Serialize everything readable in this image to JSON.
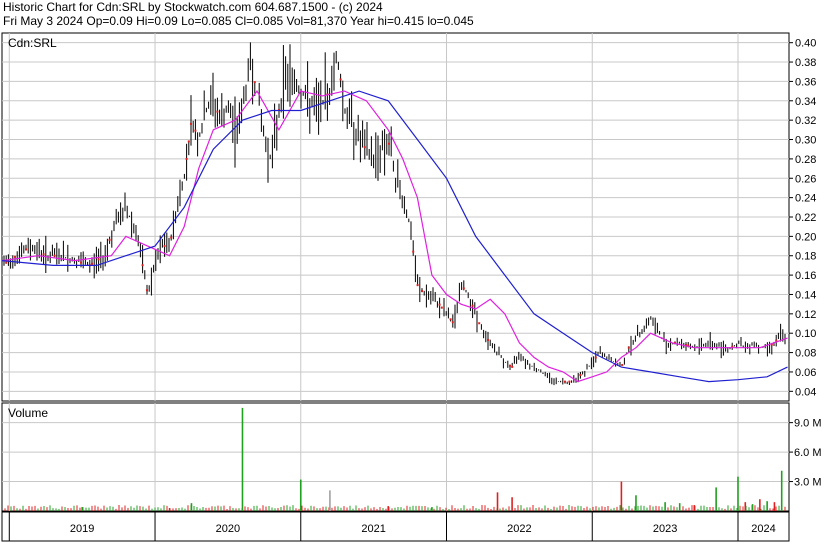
{
  "header": {
    "line1": "Historic Chart for Cdn:SRL by Stockwatch.com 604.687.1500 - (c) 2024",
    "line2": "Fri May  3 2024  Op=0.09  Hi=0.09  Lo=0.085  Cl=0.085  Vol=81,370  Year hi=0.415  lo=0.045"
  },
  "colors": {
    "price": "#000000",
    "ma_short": "#e020e0",
    "ma_long": "#2020d0",
    "vol_up": "#20a020",
    "vol_down": "#e02020",
    "vol_flat": "#a0a0a0",
    "grid": "#c8c8c8"
  },
  "chart_data": [
    {
      "type": "line",
      "symbol_label": "Cdn:SRL",
      "ylim": [
        0.03,
        0.41
      ],
      "y_ticks": [
        "0.40",
        "0.38",
        "0.36",
        "0.34",
        "0.32",
        "0.30",
        "0.28",
        "0.26",
        "0.24",
        "0.22",
        "0.20",
        "0.18",
        "0.16",
        "0.14",
        "0.12",
        "0.10",
        "0.08",
        "0.06",
        "0.04"
      ],
      "x_ticks": [
        "2019",
        "2020",
        "2021",
        "2022",
        "2023",
        "2024"
      ],
      "xlim": [
        2018.95,
        2024.35
      ],
      "series": [
        {
          "key": "close",
          "x": [
            2018.95,
            2019.05,
            2019.15,
            2019.25,
            2019.35,
            2019.45,
            2019.55,
            2019.65,
            2019.72,
            2019.8,
            2019.88,
            2019.95,
            2020.0,
            2020.05,
            2020.1,
            2020.15,
            2020.2,
            2020.25,
            2020.3,
            2020.35,
            2020.4,
            2020.45,
            2020.5,
            2020.55,
            2020.6,
            2020.65,
            2020.7,
            2020.75,
            2020.8,
            2020.85,
            2020.9,
            2020.95,
            2021.0,
            2021.05,
            2021.1,
            2021.15,
            2021.2,
            2021.25,
            2021.3,
            2021.35,
            2021.4,
            2021.45,
            2021.5,
            2021.55,
            2021.6,
            2021.65,
            2021.7,
            2021.75,
            2021.8,
            2021.85,
            2021.9,
            2021.95,
            2022.0,
            2022.05,
            2022.1,
            2022.15,
            2022.2,
            2022.25,
            2022.3,
            2022.35,
            2022.4,
            2022.45,
            2022.5,
            2022.55,
            2022.6,
            2022.65,
            2022.7,
            2022.75,
            2022.8,
            2022.85,
            2022.9,
            2022.95,
            2023.0,
            2023.05,
            2023.1,
            2023.15,
            2023.2,
            2023.25,
            2023.3,
            2023.4,
            2023.5,
            2023.6,
            2023.7,
            2023.8,
            2023.9,
            2023.95,
            2024.0,
            2024.05,
            2024.1,
            2024.15,
            2024.2,
            2024.25,
            2024.3,
            2024.34
          ],
          "values": [
            0.17,
            0.18,
            0.19,
            0.18,
            0.18,
            0.175,
            0.17,
            0.18,
            0.21,
            0.23,
            0.2,
            0.14,
            0.17,
            0.19,
            0.19,
            0.23,
            0.26,
            0.32,
            0.3,
            0.33,
            0.34,
            0.32,
            0.33,
            0.31,
            0.33,
            0.38,
            0.35,
            0.3,
            0.28,
            0.33,
            0.37,
            0.36,
            0.35,
            0.34,
            0.33,
            0.34,
            0.35,
            0.39,
            0.33,
            0.32,
            0.3,
            0.29,
            0.28,
            0.29,
            0.3,
            0.26,
            0.24,
            0.21,
            0.15,
            0.14,
            0.135,
            0.13,
            0.12,
            0.11,
            0.15,
            0.14,
            0.12,
            0.1,
            0.09,
            0.08,
            0.07,
            0.065,
            0.08,
            0.07,
            0.065,
            0.06,
            0.055,
            0.05,
            0.05,
            0.05,
            0.055,
            0.06,
            0.07,
            0.08,
            0.075,
            0.07,
            0.065,
            0.085,
            0.095,
            0.115,
            0.09,
            0.09,
            0.085,
            0.09,
            0.085,
            0.085,
            0.09,
            0.085,
            0.09,
            0.085,
            0.085,
            0.09,
            0.1,
            0.085
          ]
        },
        {
          "key": "ma_short",
          "x": [
            2018.95,
            2019.2,
            2019.45,
            2019.7,
            2019.8,
            2019.95,
            2020.1,
            2020.2,
            2020.3,
            2020.4,
            2020.55,
            2020.7,
            2020.85,
            2021.0,
            2021.15,
            2021.3,
            2021.45,
            2021.6,
            2021.7,
            2021.8,
            2021.9,
            2022.0,
            2022.1,
            2022.2,
            2022.3,
            2022.4,
            2022.5,
            2022.6,
            2022.7,
            2022.8,
            2022.9,
            2023.0,
            2023.1,
            2023.2,
            2023.3,
            2023.4,
            2023.55,
            2023.7,
            2023.85,
            2024.0,
            2024.15,
            2024.34
          ],
          "values": [
            0.175,
            0.18,
            0.175,
            0.18,
            0.2,
            0.19,
            0.18,
            0.21,
            0.27,
            0.31,
            0.32,
            0.35,
            0.31,
            0.35,
            0.345,
            0.35,
            0.34,
            0.31,
            0.28,
            0.24,
            0.16,
            0.14,
            0.13,
            0.125,
            0.135,
            0.12,
            0.09,
            0.075,
            0.065,
            0.06,
            0.05,
            0.055,
            0.06,
            0.075,
            0.085,
            0.1,
            0.09,
            0.085,
            0.085,
            0.085,
            0.085,
            0.095
          ]
        },
        {
          "key": "ma_long",
          "x": [
            2018.95,
            2019.3,
            2019.6,
            2019.8,
            2020.0,
            2020.2,
            2020.4,
            2020.6,
            2020.8,
            2021.0,
            2021.2,
            2021.4,
            2021.6,
            2021.8,
            2022.0,
            2022.2,
            2022.4,
            2022.6,
            2022.8,
            2023.0,
            2023.2,
            2023.4,
            2023.6,
            2023.8,
            2024.0,
            2024.2,
            2024.34
          ],
          "values": [
            0.175,
            0.17,
            0.17,
            0.18,
            0.19,
            0.23,
            0.29,
            0.32,
            0.33,
            0.33,
            0.34,
            0.35,
            0.34,
            0.3,
            0.26,
            0.2,
            0.16,
            0.12,
            0.1,
            0.08,
            0.065,
            0.06,
            0.055,
            0.05,
            0.052,
            0.055,
            0.065
          ]
        }
      ]
    },
    {
      "type": "bar",
      "title": "Volume",
      "ylim": [
        0,
        11
      ],
      "y_ticks": [
        "9.0 M",
        "6.0 M",
        "3.0 M"
      ],
      "x": [
        2019.5,
        2020.1,
        2020.25,
        2020.6,
        2021.0,
        2021.2,
        2021.6,
        2021.9,
        2022.35,
        2022.45,
        2023.2,
        2023.3,
        2023.5,
        2023.6,
        2023.7,
        2023.85,
        2024.0,
        2024.05,
        2024.1,
        2024.15,
        2024.2,
        2024.25,
        2024.3
      ],
      "values": [
        0.4,
        0.3,
        0.8,
        10.5,
        3.2,
        2.1,
        0.5,
        0.4,
        1.9,
        1.4,
        3.0,
        1.6,
        0.9,
        0.8,
        0.6,
        2.4,
        3.5,
        0.9,
        0.7,
        1.2,
        1.0,
        0.9,
        4.1
      ],
      "up": [
        1,
        0,
        1,
        1,
        1,
        2,
        0,
        1,
        0,
        0,
        0,
        1,
        1,
        1,
        0,
        1,
        1,
        0,
        1,
        0,
        1,
        0,
        1
      ]
    }
  ]
}
